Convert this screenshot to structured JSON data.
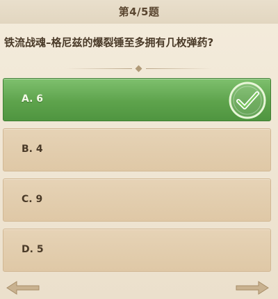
{
  "header": {
    "title": "第4/5题"
  },
  "question": {
    "text": "铁流战魂–格尼兹的爆裂锤至多拥有几枚弹药?"
  },
  "options": [
    {
      "label": "A. 6",
      "state": "correct"
    },
    {
      "label": "B. 4",
      "state": "normal"
    },
    {
      "label": "C. 9",
      "state": "normal"
    },
    {
      "label": "D. 5",
      "state": "normal"
    }
  ],
  "icons": {
    "correct_marker": "checkmark-circle-icon",
    "prev": "arrow-left-icon",
    "next": "arrow-right-icon"
  },
  "colors": {
    "correct_green": "#5ea34c",
    "option_tan": "#e2ccab",
    "text_brown": "#4a3a28"
  }
}
